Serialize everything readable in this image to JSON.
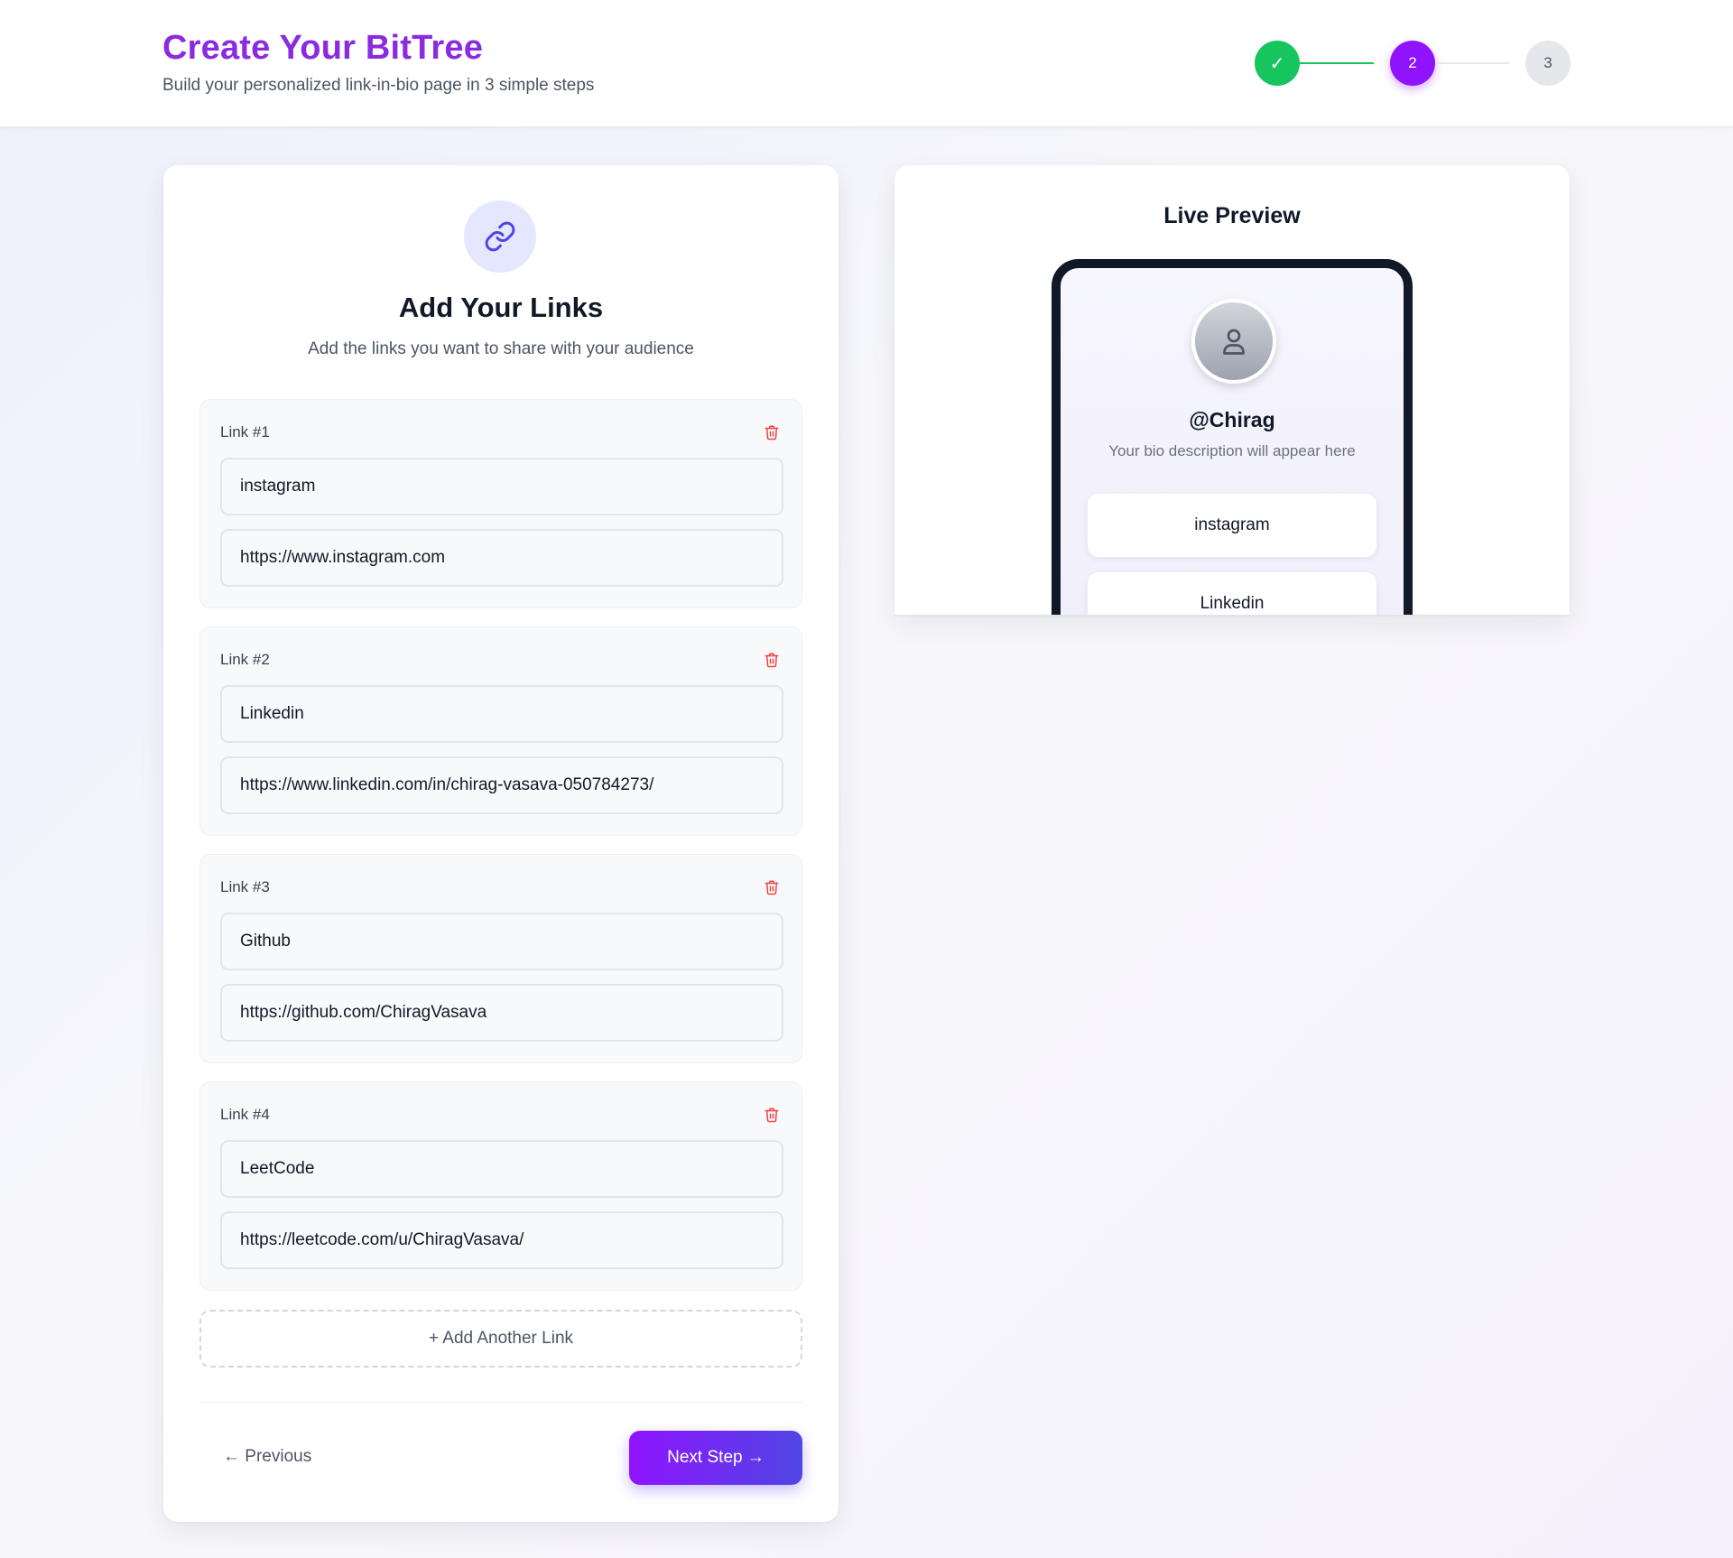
{
  "header": {
    "title": "Create Your BitTree",
    "subtitle": "Build your personalized link-in-bio page in 3 simple steps",
    "steps": [
      {
        "label": "✓",
        "state": "done"
      },
      {
        "label": "2",
        "state": "active"
      },
      {
        "label": "3",
        "state": "todo"
      }
    ]
  },
  "editor": {
    "icon": "link-icon",
    "title": "Add Your Links",
    "subtitle": "Add the links you want to share with your audience",
    "links": [
      {
        "label": "Link #1",
        "name": "instagram",
        "url": "https://www.instagram.com"
      },
      {
        "label": "Link #2",
        "name": "Linkedin",
        "url": "https://www.linkedin.com/in/chirag-vasava-050784273/"
      },
      {
        "label": "Link #3",
        "name": "Github",
        "url": "https://github.com/ChiragVasava"
      },
      {
        "label": "Link #4",
        "name": "LeetCode",
        "url": "https://leetcode.com/u/ChiragVasava/"
      }
    ],
    "add_label": "+ Add Another Link",
    "prev_label": "← Previous",
    "next_label": "Next Step →"
  },
  "preview": {
    "title": "Live Preview",
    "username": "@Chirag",
    "bio": "Your bio description will appear here",
    "links": [
      "instagram",
      "Linkedin"
    ]
  },
  "colors": {
    "brand": "#8a2be2",
    "active_step": "#9013fe",
    "done_step": "#16c55d",
    "delete": "#ef4444"
  }
}
